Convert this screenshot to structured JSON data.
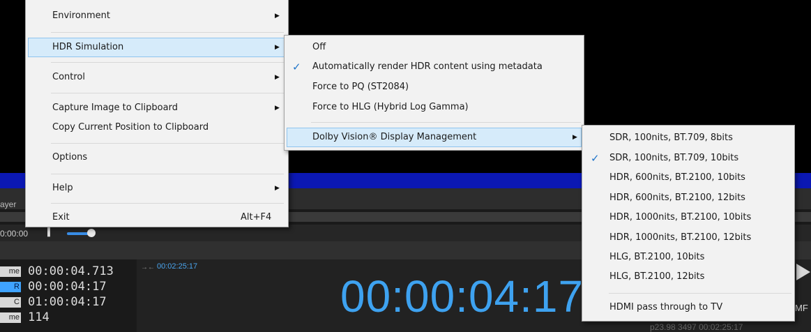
{
  "player": {
    "tab_label": "ayer",
    "position_time": "0:00:00",
    "rows": [
      {
        "label": "me",
        "value": "00:00:04.713",
        "active": false
      },
      {
        "label": "R",
        "value": "00:00:04:17",
        "active": true
      },
      {
        "label": "C",
        "value": "01:00:04:17",
        "active": false
      },
      {
        "label": "me",
        "value": "114",
        "active": false
      }
    ],
    "duration": "00:02:25:17",
    "big_timecode": "00:00:04:17",
    "status_text": "p23.98   3497   00:02:25:17",
    "mf_label": "MF"
  },
  "main_menu": {
    "items": [
      {
        "label": "Environment",
        "has_submenu": true
      },
      {
        "label": "HDR Simulation",
        "has_submenu": true,
        "highlighted": true
      },
      {
        "label": "Control",
        "has_submenu": true
      },
      {
        "label": "Capture Image to Clipboard",
        "has_submenu": true
      },
      {
        "label": "Copy Current Position to Clipboard",
        "has_submenu": false
      },
      {
        "label": "Options",
        "has_submenu": false
      },
      {
        "label": "Help",
        "has_submenu": true
      },
      {
        "label": "Exit",
        "has_submenu": false,
        "shortcut": "Alt+F4"
      }
    ]
  },
  "hdr_menu": {
    "items": [
      {
        "label": "Off",
        "checked": false
      },
      {
        "label": "Automatically render HDR content using metadata",
        "checked": true
      },
      {
        "label": "Force to PQ (ST2084)",
        "checked": false
      },
      {
        "label": "Force to HLG (Hybrid Log Gamma)",
        "checked": false
      },
      {
        "label": "Dolby Vision® Display Management",
        "checked": false,
        "has_submenu": true,
        "highlighted": true
      }
    ]
  },
  "dv_menu": {
    "items": [
      {
        "label": "SDR, 100nits, BT.709, 8bits",
        "checked": false
      },
      {
        "label": "SDR, 100nits, BT.709, 10bits",
        "checked": true
      },
      {
        "label": "HDR, 600nits, BT.2100, 10bits",
        "checked": false
      },
      {
        "label": "HDR, 600nits, BT.2100, 12bits",
        "checked": false
      },
      {
        "label": "HDR, 1000nits, BT.2100, 10bits",
        "checked": false
      },
      {
        "label": "HDR, 1000nits, BT.2100, 12bits",
        "checked": false
      },
      {
        "label": "HLG, BT.2100, 10bits",
        "checked": false
      },
      {
        "label": "HLG, BT.2100, 12bits",
        "checked": false
      },
      {
        "label": "HDMI pass through to TV",
        "checked": false
      }
    ]
  },
  "icons": {
    "check": "checkmark-icon",
    "submenu_arrow": "triangle-right-icon"
  },
  "colors": {
    "accent": "#3ea2f0",
    "menu_bg": "#f2f2f2",
    "highlight": "#d6ebfa",
    "blue_bar": "#0b18b3"
  }
}
